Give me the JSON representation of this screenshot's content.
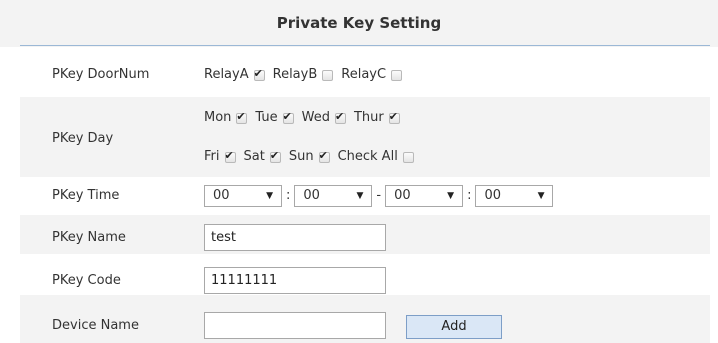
{
  "title": "Private Key Setting",
  "door_num": {
    "label": "PKey DoorNum",
    "relays": [
      {
        "name": "RelayA",
        "checked": true
      },
      {
        "name": "RelayB",
        "checked": false
      },
      {
        "name": "RelayC",
        "checked": false
      }
    ]
  },
  "day": {
    "label": "PKey Day",
    "row1": [
      {
        "name": "Mon",
        "checked": true
      },
      {
        "name": "Tue",
        "checked": true
      },
      {
        "name": "Wed",
        "checked": true
      },
      {
        "name": "Thur",
        "checked": true
      }
    ],
    "row2": [
      {
        "name": "Fri",
        "checked": true
      },
      {
        "name": "Sat",
        "checked": true
      },
      {
        "name": "Sun",
        "checked": true
      },
      {
        "name": "Check All",
        "checked": false
      }
    ]
  },
  "time": {
    "label": "PKey Time",
    "start_hour": "00",
    "start_minute": "00",
    "end_hour": "00",
    "end_minute": "00",
    "colon": ":",
    "dash": "-"
  },
  "name": {
    "label": "PKey Name",
    "value": "test"
  },
  "code": {
    "label": "PKey Code",
    "value": "11111111"
  },
  "device": {
    "label": "Device Name",
    "value": ""
  },
  "add_label": "Add"
}
